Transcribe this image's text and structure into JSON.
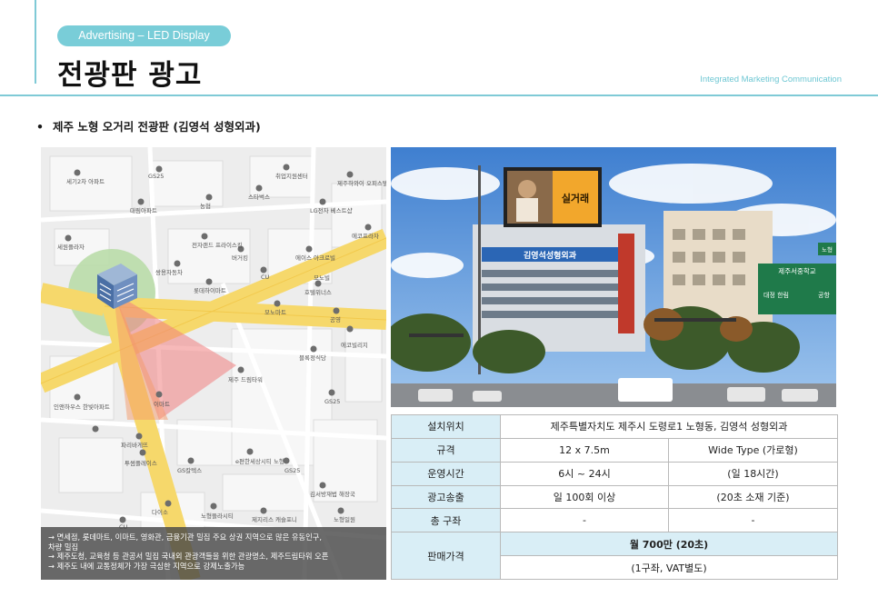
{
  "header": {
    "category": "Advertising – LED Display",
    "title": "전광판 광고",
    "tagline": "Integrated Marketing Communication"
  },
  "section": {
    "bullet": "•",
    "heading": "제주 노형 오거리 전광판 (김영석 성형외과)"
  },
  "map": {
    "labels": [
      "세기2차 아파트",
      "GS25",
      "취업지원센터",
      "제주하와이 오피스텔",
      "대림아파트",
      "농협",
      "스타벅스",
      "LG전자 베스트샵",
      "에코프라자",
      "세원플라자",
      "전자랜드 프라이스킹",
      "버거킹",
      "에이스 아크로빌",
      "쌍용자동차",
      "CU",
      "롯데하이마트",
      "호텔위너스",
      "모노빌",
      "모노마트",
      "공영",
      "에코빌리지",
      "블록정식당",
      "제주 드림타워",
      "인앤하우스 한빛아파트",
      "이마트",
      "GS25",
      "파리바게뜨",
      "투썸플레이스",
      "GS칼텍스",
      "e편한세상시티 노형",
      "GS25",
      "김서방재법 해장국",
      "다이소",
      "노형뜰라시티",
      "제지리스 캐슬포니",
      "CU",
      "노형일원"
    ],
    "notes": [
      "→ 면세점, 롯데마트, 이마트, 영화관, 금융기관 밀집 주요 상권 지역으로 많은 유동인구,",
      "차량 밀집",
      "→ 제주도청, 교육청 등 관공서 밀집 국내외 관광객들을 위한 관광명소, 제주드림타워 오픈",
      "→ 제주도 내에 교통정체가 가장 극심한 지역으로 강제노출가능"
    ]
  },
  "photo": {
    "building_sign": "김영석성형외과",
    "billboard_text": "실거래",
    "road_sign_title": "제주서중학교",
    "road_sign_left": "대정 한림",
    "road_sign_right": "공항",
    "corner_sign": "노형"
  },
  "table": {
    "rows": [
      {
        "label": "설치위치",
        "value": "제주특별자치도 제주시 도령로1 노형동, 김영석 성형외과"
      },
      {
        "label": "규격",
        "col1": "12 x 7.5m",
        "col2": "Wide Type (가로형)"
      },
      {
        "label": "운영시간",
        "col1": "6시 ~ 24시",
        "col2": "(일 18시간)"
      },
      {
        "label": "광고송출",
        "col1": "일 100회 이상",
        "col2": "(20초 소재 기준)"
      },
      {
        "label": "총 구좌",
        "col1": "-",
        "col2": "-"
      },
      {
        "label": "판매가격",
        "price": "월 700만 (20초)",
        "price_note": "(1구좌, VAT별도)"
      }
    ]
  },
  "colors": {
    "accent": "#79cdd8",
    "road": "#f6d86b",
    "beam": "#f4a3a3",
    "table_header": "#d9eef6"
  }
}
